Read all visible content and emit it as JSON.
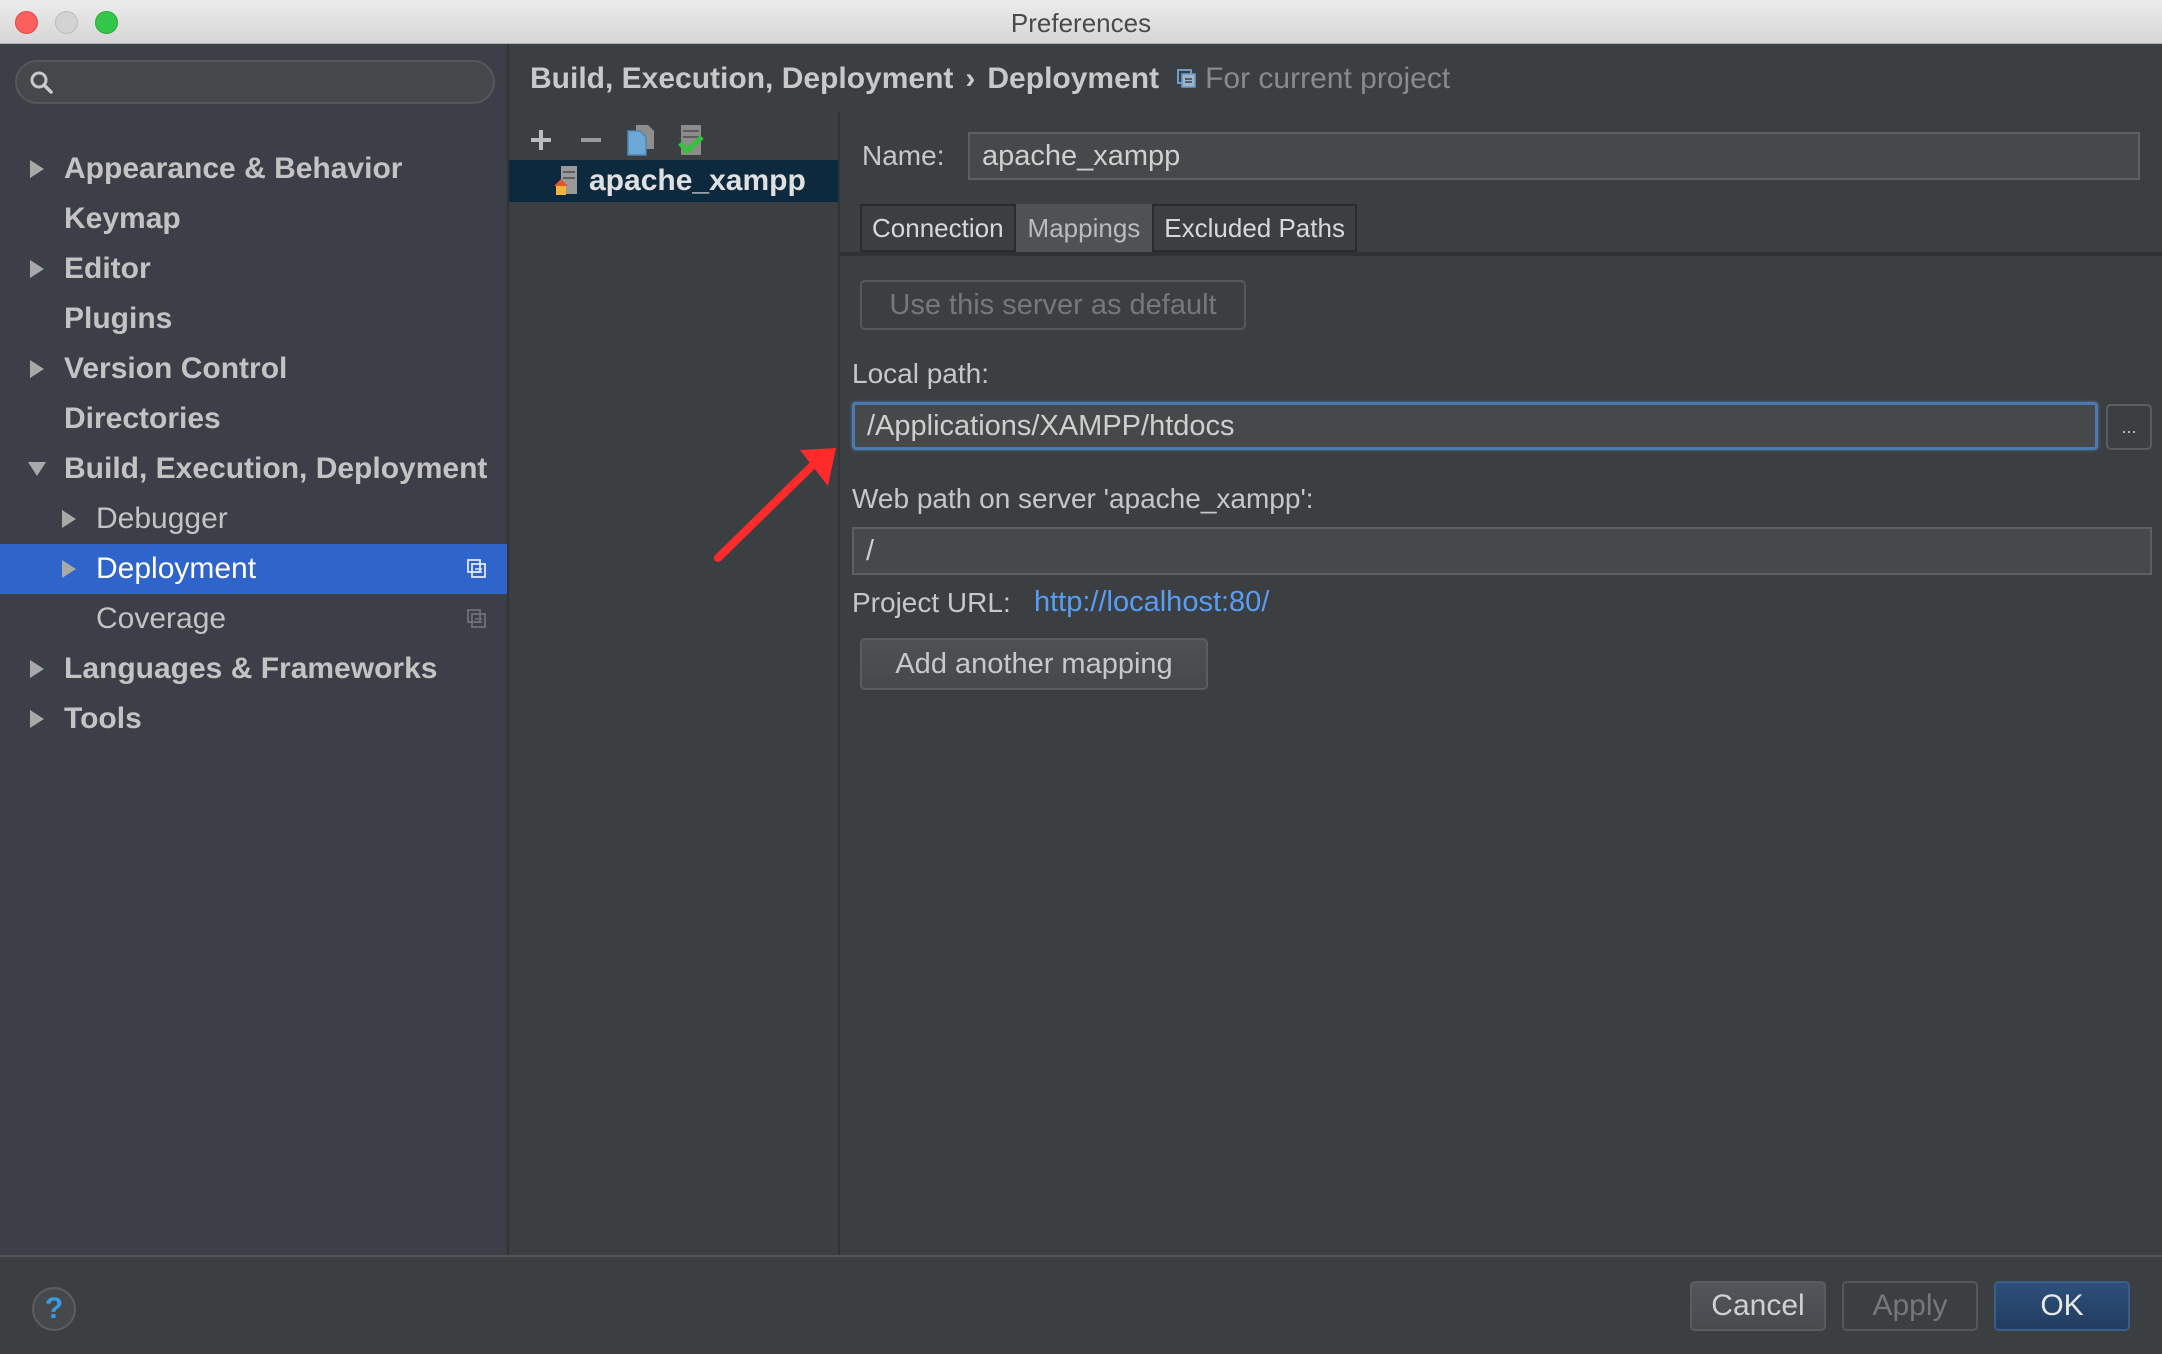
{
  "window": {
    "title": "Preferences"
  },
  "sidebar": {
    "search": {
      "value": "",
      "placeholder": ""
    },
    "items": [
      {
        "label": "Appearance & Behavior",
        "expander": "collapsed",
        "level": 0,
        "bold": true
      },
      {
        "label": "Keymap",
        "expander": "none",
        "level": 0,
        "bold": true
      },
      {
        "label": "Editor",
        "expander": "collapsed",
        "level": 0,
        "bold": true
      },
      {
        "label": "Plugins",
        "expander": "none",
        "level": 0,
        "bold": true
      },
      {
        "label": "Version Control",
        "expander": "collapsed",
        "level": 0,
        "bold": true
      },
      {
        "label": "Directories",
        "expander": "none",
        "level": 0,
        "bold": true
      },
      {
        "label": "Build, Execution, Deployment",
        "expander": "expanded",
        "level": 0,
        "bold": true
      },
      {
        "label": "Debugger",
        "expander": "collapsed",
        "level": 1,
        "bold": false
      },
      {
        "label": "Deployment",
        "expander": "collapsed",
        "level": 1,
        "bold": false,
        "selected": true,
        "project_scope_icon": true
      },
      {
        "label": "Coverage",
        "expander": "none",
        "level": 1,
        "bold": false,
        "project_scope_icon": true
      },
      {
        "label": "Languages & Frameworks",
        "expander": "collapsed",
        "level": 0,
        "bold": true
      },
      {
        "label": "Tools",
        "expander": "collapsed",
        "level": 0,
        "bold": true
      }
    ]
  },
  "breadcrumb": {
    "parent": "Build, Execution, Deployment",
    "separator": "›",
    "current": "Deployment",
    "scope": "For current project"
  },
  "server_list": {
    "toolbar": [
      {
        "name": "add-server",
        "icon": "plus-icon"
      },
      {
        "name": "remove-server",
        "icon": "minus-icon"
      },
      {
        "name": "copy-server",
        "icon": "copy-icon"
      },
      {
        "name": "use-as-default",
        "icon": "server-check-icon"
      }
    ],
    "servers": [
      {
        "name": "apache_xampp",
        "icon": "local-server-icon",
        "selected": true
      }
    ]
  },
  "form": {
    "name_label": "Name:",
    "name_value": "apache_xampp",
    "tabs": [
      {
        "label": "Connection",
        "active": false
      },
      {
        "label": "Mappings",
        "active": true
      },
      {
        "label": "Excluded Paths",
        "active": false
      }
    ],
    "default_button": "Use this server as default",
    "local_path_label": "Local path:",
    "local_path_value": "/Applications/XAMPP/htdocs",
    "browse_label": "...",
    "web_path_label": "Web path on server 'apache_xampp':",
    "web_path_value": "/",
    "project_url_label": "Project URL:",
    "project_url_value": "http://localhost:80/",
    "add_mapping_button": "Add another mapping"
  },
  "footer": {
    "help": "?",
    "cancel": "Cancel",
    "apply": "Apply",
    "ok": "OK"
  },
  "colors": {
    "selection": "#2f65ca",
    "link": "#589df6",
    "annotation_arrow": "#ff2a2a"
  }
}
